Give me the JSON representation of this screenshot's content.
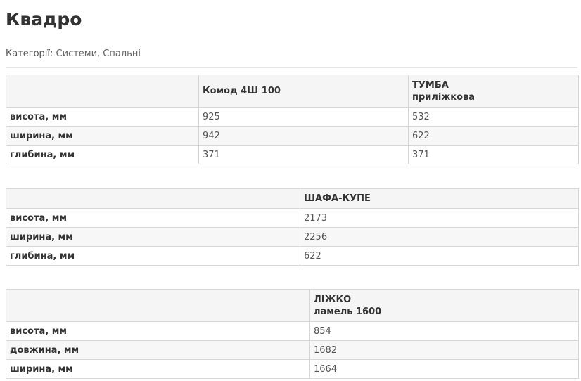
{
  "page": {
    "title": "Квадро",
    "categories_label": "Категорії:",
    "categories": "Системи, Спальні"
  },
  "tables": [
    {
      "columns": [
        {
          "title": "",
          "subtitle": ""
        },
        {
          "title": "Комод 4Ш 100",
          "subtitle": ""
        },
        {
          "title": "ТУМБА",
          "subtitle": "приліжкова"
        }
      ],
      "rows": [
        {
          "label": "висота, мм",
          "values": [
            "925",
            "532"
          ]
        },
        {
          "label": "ширина, мм",
          "values": [
            "942",
            "622"
          ]
        },
        {
          "label": "глибина, мм",
          "values": [
            "371",
            "371"
          ]
        }
      ]
    },
    {
      "columns": [
        {
          "title": "",
          "subtitle": ""
        },
        {
          "title": "ШАФА-КУПЕ",
          "subtitle": ""
        }
      ],
      "rows": [
        {
          "label": "висота, мм",
          "values": [
            "2173"
          ]
        },
        {
          "label": "ширина, мм",
          "values": [
            "2256"
          ]
        },
        {
          "label": "глибина, мм",
          "values": [
            "622"
          ]
        }
      ]
    },
    {
      "columns": [
        {
          "title": "",
          "subtitle": ""
        },
        {
          "title": "ЛІЖКО",
          "subtitle": "ламель 1600"
        }
      ],
      "rows": [
        {
          "label": "висота, мм",
          "values": [
            "854"
          ]
        },
        {
          "label": "довжина, мм",
          "values": [
            "1682"
          ]
        },
        {
          "label": "ширина, мм",
          "values": [
            "1664"
          ]
        }
      ]
    }
  ]
}
